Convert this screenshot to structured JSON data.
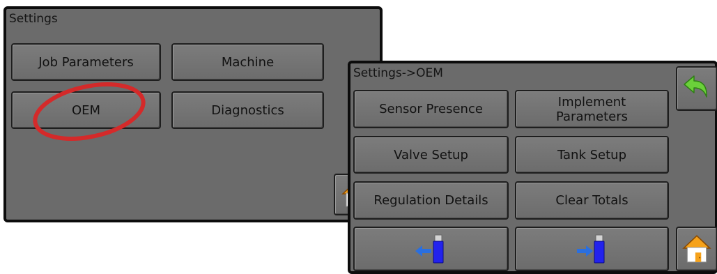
{
  "settings_panel": {
    "title": "Settings",
    "buttons": {
      "job_parameters": "Job Parameters",
      "machine": "Machine",
      "oem": "OEM",
      "diagnostics": "Diagnostics"
    },
    "home_icon": "home-icon"
  },
  "oem_panel": {
    "title": "Settings->OEM",
    "buttons": {
      "sensor_presence": "Sensor Presence",
      "implement_parameters": "Implement Parameters",
      "valve_setup": "Valve Setup",
      "tank_setup": "Tank Setup",
      "regulation_details": "Regulation Details",
      "clear_totals": "Clear Totals"
    },
    "usb_import_icon": "usb-import-icon",
    "usb_export_icon": "usb-export-icon",
    "back_icon": "back-arrow-icon",
    "home_icon": "home-icon"
  },
  "annotation": {
    "highlight": "OEM",
    "color": "#d42a2a"
  },
  "colors": {
    "panel": "#6b6b6b",
    "button": "#757575",
    "border": "#0c0c0c"
  }
}
